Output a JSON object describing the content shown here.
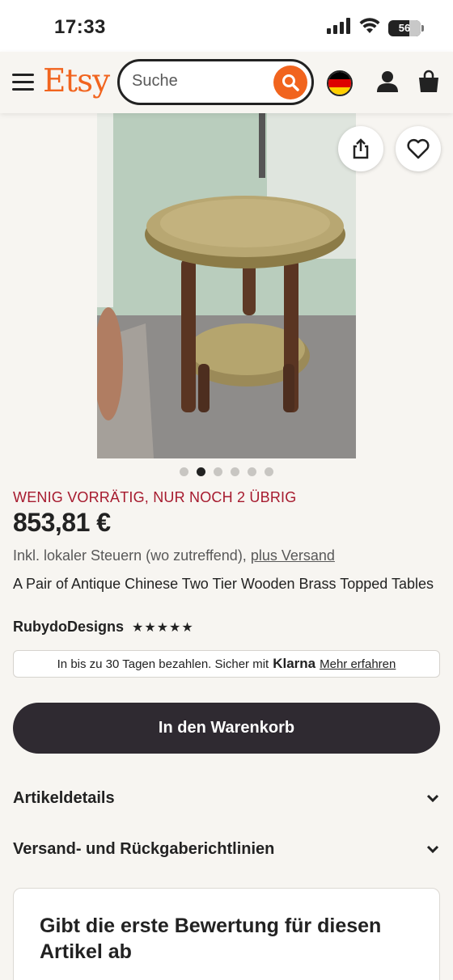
{
  "status_bar": {
    "time": "17:33",
    "battery": "56",
    "icons": [
      "signal-icon",
      "wifi-icon",
      "battery-icon"
    ]
  },
  "header": {
    "logo": "Etsy",
    "search_placeholder": "Suche",
    "icons": [
      "menu-icon",
      "search-icon",
      "germany-flag-icon",
      "user-icon",
      "shopping-bag-icon"
    ]
  },
  "gallery": {
    "image_count": 6,
    "active_index": 1,
    "actions": [
      "share-icon",
      "heart-icon"
    ]
  },
  "product": {
    "stock_notice": "WENIG VORRÄTIG, NUR NOCH 2 ÜBRIG",
    "price": "853,81 €",
    "tax_note": "Inkl. lokaler Steuern (wo zutreffend),",
    "shipping_link": "plus Versand",
    "title": "A Pair of Antique Chinese Two Tier Wooden Brass Topped Tables",
    "shop_name": "RubydoDesigns",
    "rating": 5,
    "rating_stars": "★★★★★"
  },
  "klarna": {
    "text": "In bis zu 30 Tagen bezahlen. Sicher mit",
    "brand": "Klarna",
    "link": "Mehr erfahren"
  },
  "cart_button": "In den Warenkorb",
  "sections": [
    {
      "label": "Artikeldetails"
    },
    {
      "label": "Versand- und Rückgaberichtlinien"
    }
  ],
  "review_prompt": "Gibt die erste Bewertung für diesen Artikel ab",
  "colors": {
    "brand": "#f1641e",
    "stock": "#a61a2e",
    "button": "#2f2a31",
    "background": "#f7f5f1"
  }
}
